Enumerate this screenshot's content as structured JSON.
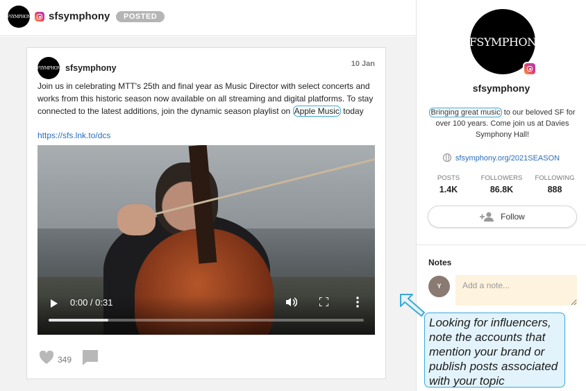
{
  "header": {
    "account_name": "sfsymphony",
    "status_badge": "POSTED",
    "platform_icon": "instagram-icon"
  },
  "post": {
    "account_name": "sfsymphony",
    "date": "10 Jan",
    "text_before": "Join us in celebrating MTT's 25th and final year as Music Director with select concerts and works from this historic season now available on all streaming and digital platforms. To stay connected to the latest additions, join the dynamic season playlist on ",
    "text_highlight": "Apple Music",
    "text_after": " today",
    "link": "https://sfs.lnk.to/dcs",
    "video": {
      "time": "0:00 / 0:31",
      "progress_fraction": 0.19
    },
    "likes": "349"
  },
  "profile": {
    "logo_text": "SFSYMPHONY",
    "name": "sfsymphony",
    "bio_highlight": "Bringing great music",
    "bio_rest": " to our beloved SF for over 100 years. Come join us at Davies Symphony Hall!",
    "website": "sfsymphony.org/2021SEASON",
    "stats": [
      {
        "label": "POSTS",
        "value": "1.4K"
      },
      {
        "label": "FOLLOWERS",
        "value": "86.8K"
      },
      {
        "label": "FOLLOWING",
        "value": "888"
      }
    ],
    "follow_label": "Follow"
  },
  "notes": {
    "title": "Notes",
    "avatar_initial": "Y",
    "placeholder": "Add a note..."
  },
  "callout": {
    "text": "Looking for influencers, note the accounts that mention your brand or publish posts associated with your topic"
  },
  "colors": {
    "highlight_border": "#3aa8d8",
    "callout_bg": "#e3f3fb",
    "link": "#2a6ebb",
    "note_bg": "#fdf3de"
  }
}
